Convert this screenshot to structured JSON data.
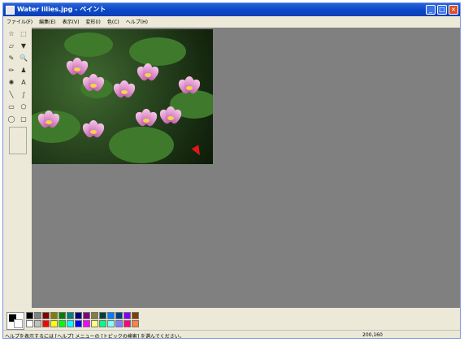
{
  "window": {
    "title": "Water lilies.jpg - ペイント"
  },
  "title_buttons": {
    "minimize": "_",
    "maximize": "□",
    "close": "×"
  },
  "menu": [
    "ファイル(F)",
    "編集(E)",
    "表示(V)",
    "変形(I)",
    "色(C)",
    "ヘルプ(H)"
  ],
  "tools": [
    {
      "name": "free-select-icon",
      "glyph": "☆"
    },
    {
      "name": "rect-select-icon",
      "glyph": "⬚"
    },
    {
      "name": "eraser-icon",
      "glyph": "▱"
    },
    {
      "name": "fill-icon",
      "glyph": "▼"
    },
    {
      "name": "eyedropper-icon",
      "glyph": "✎"
    },
    {
      "name": "magnifier-icon",
      "glyph": "🔍"
    },
    {
      "name": "pencil-icon",
      "glyph": "✏"
    },
    {
      "name": "brush-icon",
      "glyph": "♟"
    },
    {
      "name": "airbrush-icon",
      "glyph": "✺"
    },
    {
      "name": "text-icon",
      "glyph": "A"
    },
    {
      "name": "line-icon",
      "glyph": "╲"
    },
    {
      "name": "curve-icon",
      "glyph": "∫"
    },
    {
      "name": "rectangle-icon",
      "glyph": "▭"
    },
    {
      "name": "polygon-icon",
      "glyph": "⬠"
    },
    {
      "name": "ellipse-icon",
      "glyph": "◯"
    },
    {
      "name": "rounded-rect-icon",
      "glyph": "▢"
    }
  ],
  "palette": {
    "foreground": "#000000",
    "background": "#ffffff",
    "colors": [
      "#000000",
      "#808080",
      "#800000",
      "#808000",
      "#008000",
      "#008080",
      "#000080",
      "#800080",
      "#808040",
      "#004040",
      "#0080ff",
      "#004080",
      "#8000ff",
      "#804000",
      "#ffffff",
      "#c0c0c0",
      "#ff0000",
      "#ffff00",
      "#00ff00",
      "#00ffff",
      "#0000ff",
      "#ff00ff",
      "#ffff80",
      "#00ff80",
      "#80ffff",
      "#8080ff",
      "#ff0080",
      "#ff8040"
    ]
  },
  "status": {
    "help": "ヘルプを表示するには [ヘルプ] メニューの [トピックの検索] を選んでください。",
    "coordinates": "200,160"
  },
  "image": {
    "subject": "water-lilies-photo"
  }
}
